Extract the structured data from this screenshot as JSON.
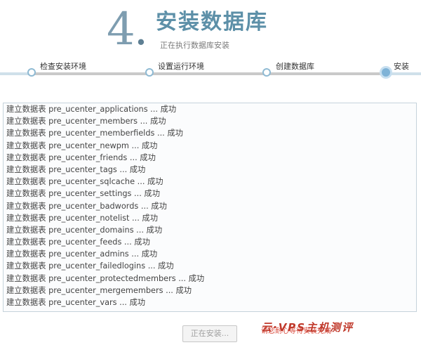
{
  "header": {
    "step_number": "4",
    "step_dot": ".",
    "title": "安装数据库",
    "subtitle": "正在执行数据库安装"
  },
  "progress": {
    "steps": [
      {
        "label": "检查安装环境",
        "state": "done"
      },
      {
        "label": "设置运行环境",
        "state": "done"
      },
      {
        "label": "创建数据库",
        "state": "done"
      },
      {
        "label": "安装",
        "state": "active"
      }
    ]
  },
  "log": {
    "lines": [
      "建立数据表 pre_ucenter_applications ... 成功",
      "建立数据表 pre_ucenter_members ... 成功",
      "建立数据表 pre_ucenter_memberfields ... 成功",
      "建立数据表 pre_ucenter_newpm ... 成功",
      "建立数据表 pre_ucenter_friends ... 成功",
      "建立数据表 pre_ucenter_tags ... 成功",
      "建立数据表 pre_ucenter_sqlcache ... 成功",
      "建立数据表 pre_ucenter_settings ... 成功",
      "建立数据表 pre_ucenter_badwords ... 成功",
      "建立数据表 pre_ucenter_notelist ... 成功",
      "建立数据表 pre_ucenter_domains ... 成功",
      "建立数据表 pre_ucenter_feeds ... 成功",
      "建立数据表 pre_ucenter_admins ... 成功",
      "建立数据表 pre_ucenter_failedlogins ... 成功",
      "建立数据表 pre_ucenter_protectedmembers ... 成功",
      "建立数据表 pre_ucenter_mergemembers ... 成功",
      "建立数据表 pre_ucenter_vars ... 成功"
    ]
  },
  "footer": {
    "installing_button": "正在安装...",
    "wait_notice": "请您耐心等待安装完成",
    "watermark": "云·VPS主机测评"
  },
  "colors": {
    "title": "#5d90a8",
    "step_number": "#7e9db0",
    "progress_done": "#c9c9c9",
    "progress_track": "#cfe0ea",
    "node_active": "#7fb3d7",
    "log_border": "#c6d3db"
  }
}
